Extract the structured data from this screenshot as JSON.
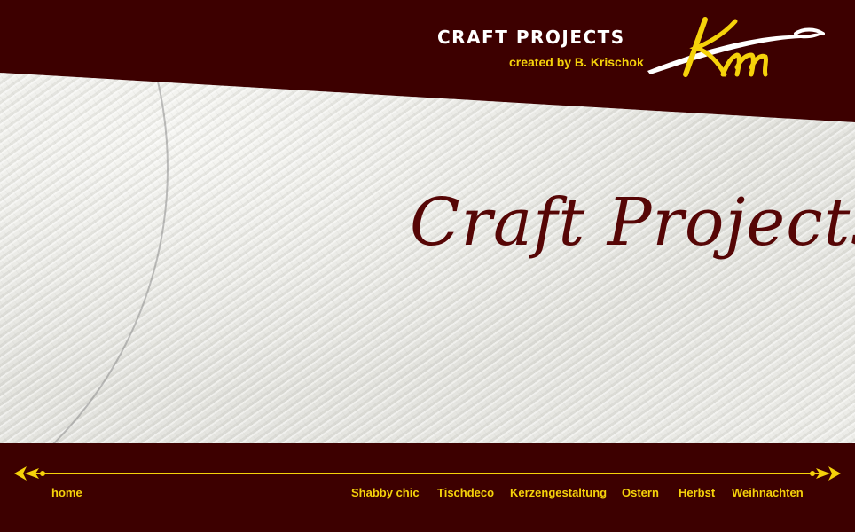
{
  "header": {
    "brand_title": "CRAFT PROJECTS",
    "brand_subtitle": "created by B. Krischok",
    "logo_text": "Km"
  },
  "hero": {
    "title": "Craft Projects"
  },
  "nav": {
    "home": "home",
    "items": [
      "Shabby chic",
      "Tischdeco",
      "Kerzengestaltung",
      "Ostern",
      "Herbst",
      "Weihnachten"
    ]
  },
  "colors": {
    "background": "#3d0000",
    "accent_yellow": "#f5d20a",
    "hero_text": "#560606"
  }
}
